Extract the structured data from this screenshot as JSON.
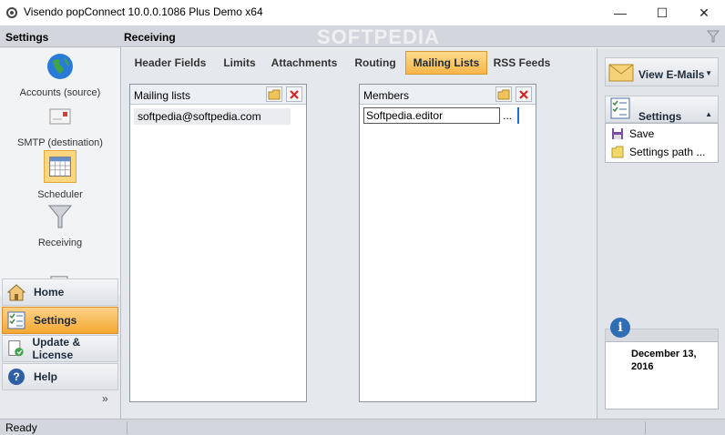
{
  "window": {
    "title": "Visendo popConnect 10.0.0.1086 Plus Demo x64",
    "minimize": "—",
    "maximize": "☐",
    "close": "✕"
  },
  "left_pane": {
    "header": "Settings",
    "items": [
      {
        "label": "Accounts (source)",
        "icon": "globe-icon"
      },
      {
        "label": "SMTP (destination)",
        "icon": "mail-card-icon"
      },
      {
        "label": "Scheduler",
        "icon": "calendar-icon",
        "selected": true
      },
      {
        "label": "Receiving",
        "icon": "funnel-icon"
      }
    ],
    "big_buttons": [
      {
        "label": "Home",
        "icon": "home-icon"
      },
      {
        "label": "Settings",
        "icon": "checklist-icon",
        "active": true
      },
      {
        "label": "Update & License",
        "icon": "update-icon"
      },
      {
        "label": "Help",
        "icon": "help-icon"
      }
    ],
    "expand_chevron": "»"
  },
  "main": {
    "header": "Receiving",
    "watermark": "SOFTPEDIA",
    "tabs": [
      {
        "label": "Header Fields"
      },
      {
        "label": "Limits"
      },
      {
        "label": "Attachments"
      },
      {
        "label": "Routing"
      },
      {
        "label": "Mailing Lists",
        "active": true
      },
      {
        "label": "RSS Feeds"
      }
    ],
    "mailing_lists": {
      "title": "Mailing lists",
      "items": [
        "softpedia@softpedia.com"
      ]
    },
    "members": {
      "title": "Members",
      "input_value": "Softpedia.editor",
      "browse_label": "..."
    }
  },
  "right_pane": {
    "view_emails": "View E-Mails",
    "settings": "Settings",
    "menu": [
      {
        "label": "Save",
        "icon": "save-icon"
      },
      {
        "label": "Settings path ...",
        "icon": "folder-icon"
      }
    ],
    "date_line1": "December 13,",
    "date_line2": "2016"
  },
  "status": {
    "text": "Ready"
  },
  "colors": {
    "accent_orange": "#f7b649",
    "header_gray": "#d3d6dc",
    "pane_gray": "#e5e8ec"
  }
}
